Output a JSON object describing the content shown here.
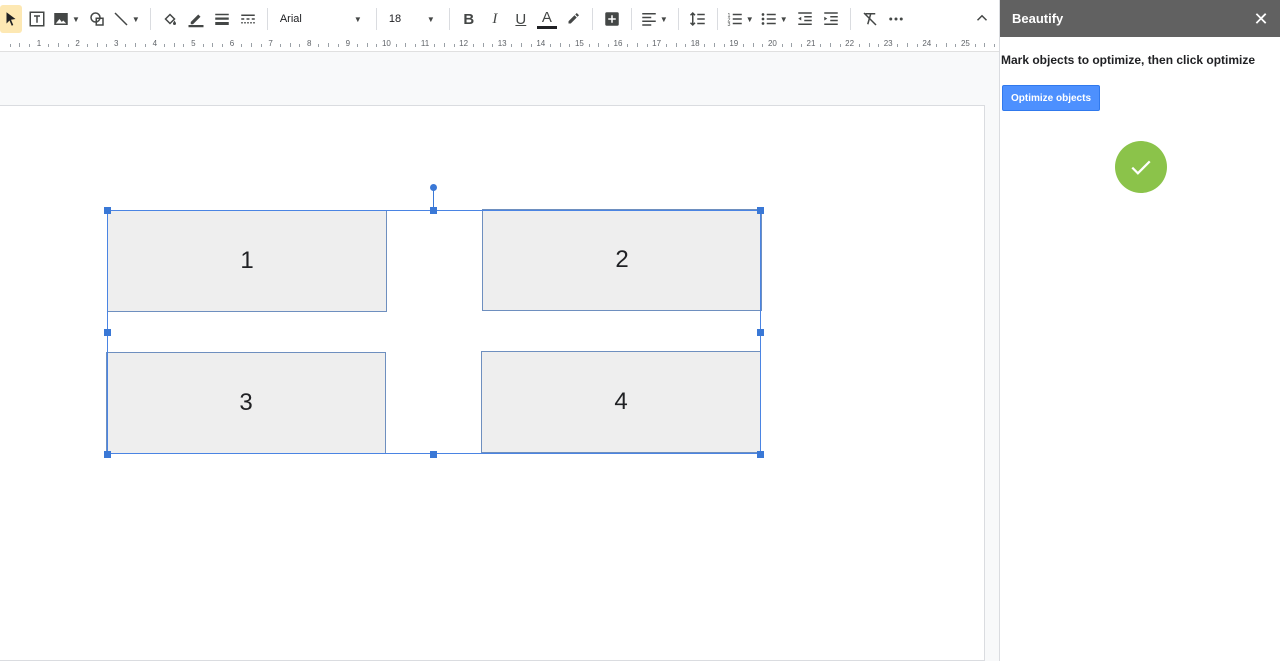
{
  "toolbar": {
    "font_name": "Arial",
    "font_size": "18",
    "bold_label": "B",
    "italic_label": "I",
    "underline_label": "U",
    "text_color_label": "A",
    "text_color_bar": "#202124",
    "icons": [
      "select-cursor-icon",
      "text-box-icon",
      "image-icon",
      "shape-icon",
      "line-icon",
      "fill-color-icon",
      "border-color-icon",
      "border-weight-icon",
      "border-dash-icon",
      "insert-comment-icon",
      "align-icon",
      "line-spacing-icon",
      "numbered-list-icon",
      "bulleted-list-icon",
      "decrease-indent-icon",
      "increase-indent-icon",
      "clear-formatting-icon",
      "more-icon",
      "collapse-icon"
    ]
  },
  "ruler": {
    "labels": [
      "1",
      "2",
      "3",
      "4",
      "5",
      "6",
      "7",
      "8",
      "9",
      "10",
      "11",
      "12",
      "13",
      "14",
      "15",
      "16",
      "17",
      "18",
      "19",
      "20",
      "21",
      "22",
      "23",
      "24",
      "25"
    ]
  },
  "canvas": {
    "shapes": [
      {
        "label": "1"
      },
      {
        "label": "2"
      },
      {
        "label": "3"
      },
      {
        "label": "4"
      }
    ]
  },
  "sidebar": {
    "title": "Beautify",
    "close_label": "✕",
    "instructions": "Mark objects to optimize, then click optimize",
    "button_label": "Optimize objects",
    "success_color": "#8bc34a"
  }
}
